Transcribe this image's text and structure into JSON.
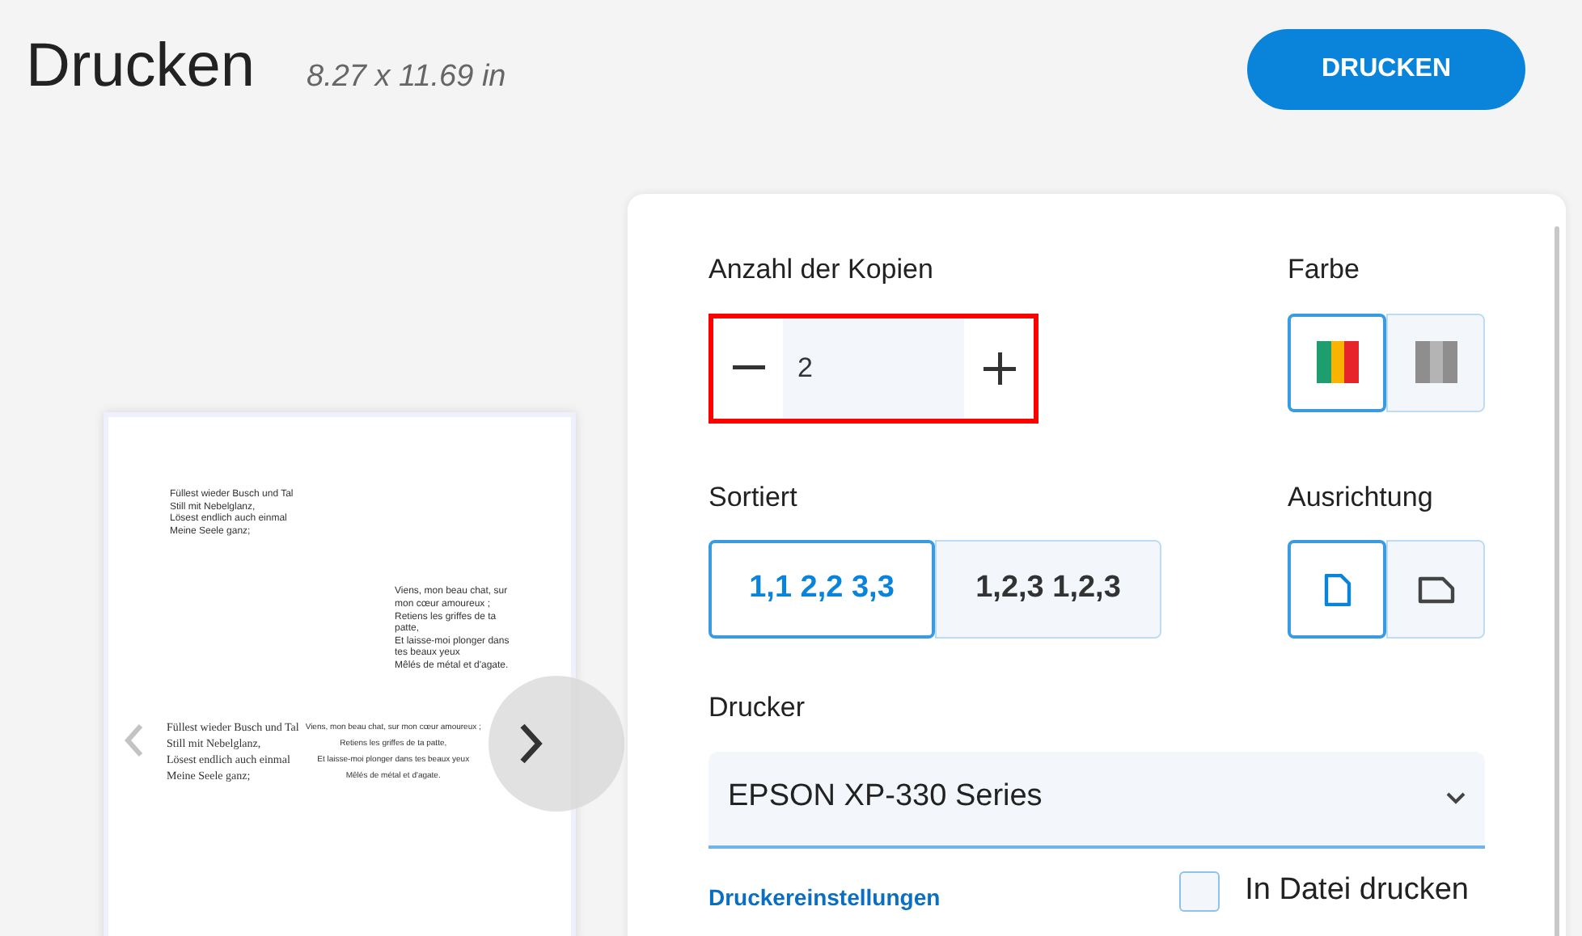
{
  "title": "Drucken",
  "page_size": "8.27 x 11.69 in",
  "print_button": "DRUCKEN",
  "preview": {
    "blocks": [
      {
        "kind": "sans",
        "lines": [
          "Füllest wieder Busch und Tal",
          "Still mit Nebelglanz,",
          "Lösest endlich auch einmal",
          "Meine Seele ganz;"
        ]
      },
      {
        "kind": "sans-narrow",
        "lines": [
          "Viens, mon beau chat, sur",
          "mon cœur amoureux ;",
          "Retiens les griffes de ta",
          "patte,",
          "Et laisse-moi plonger dans",
          "tes beaux yeux",
          "Mêlés de métal et d'agate."
        ]
      },
      {
        "kind": "serif",
        "lines": [
          "Füllest wieder Busch und Tal",
          "Still mit Nebelglanz,",
          "Lösest endlich auch einmal",
          "Meine Seele ganz;"
        ]
      },
      {
        "kind": "sans-center",
        "lines": [
          "Viens, mon beau chat, sur mon cœur amoureux ;",
          "Retiens les griffes de ta patte,",
          "Et laisse-moi plonger dans tes beaux yeux",
          "Mêlés de métal et d'agate."
        ]
      }
    ]
  },
  "copies": {
    "label": "Anzahl der Kopien",
    "value": "2",
    "highlighted": true
  },
  "color": {
    "label": "Farbe",
    "options": [
      {
        "kind": "color",
        "selected": true
      },
      {
        "kind": "gray",
        "selected": false
      }
    ]
  },
  "collate": {
    "label": "Sortiert",
    "options": [
      {
        "text": "1,1 2,2 3,3",
        "selected": true
      },
      {
        "text": "1,2,3 1,2,3",
        "selected": false
      }
    ]
  },
  "orientation": {
    "label": "Ausrichtung",
    "options": [
      {
        "kind": "portrait",
        "selected": true
      },
      {
        "kind": "landscape",
        "selected": false
      }
    ]
  },
  "printer": {
    "label": "Drucker",
    "value": "EPSON XP-330 Series"
  },
  "settings_link": "Druckereinstellungen",
  "print_to_file": {
    "label": "In Datei drucken",
    "checked": false
  }
}
